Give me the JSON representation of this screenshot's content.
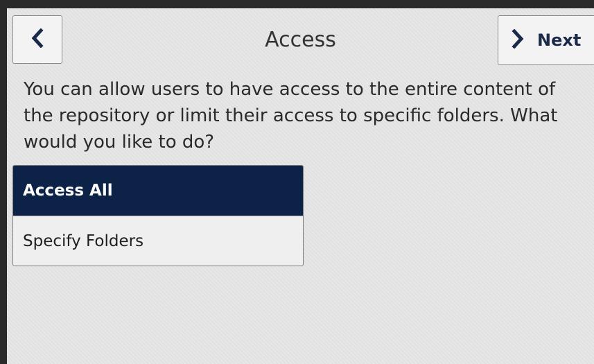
{
  "header": {
    "title": "Access",
    "back_icon": "chevron-left-icon",
    "next_icon": "chevron-right-icon",
    "next_label": "Next"
  },
  "prompt": "You can allow users to have access to the entire content of the repository or limit their access to specific folders. What would you like to do?",
  "options": [
    {
      "label": "Access All",
      "selected": true
    },
    {
      "label": "Specify Folders",
      "selected": false
    }
  ],
  "colors": {
    "selected_bg": "#0c2347",
    "accent_text": "#1b2a4a",
    "screen_bg": "#e6e6e6"
  }
}
